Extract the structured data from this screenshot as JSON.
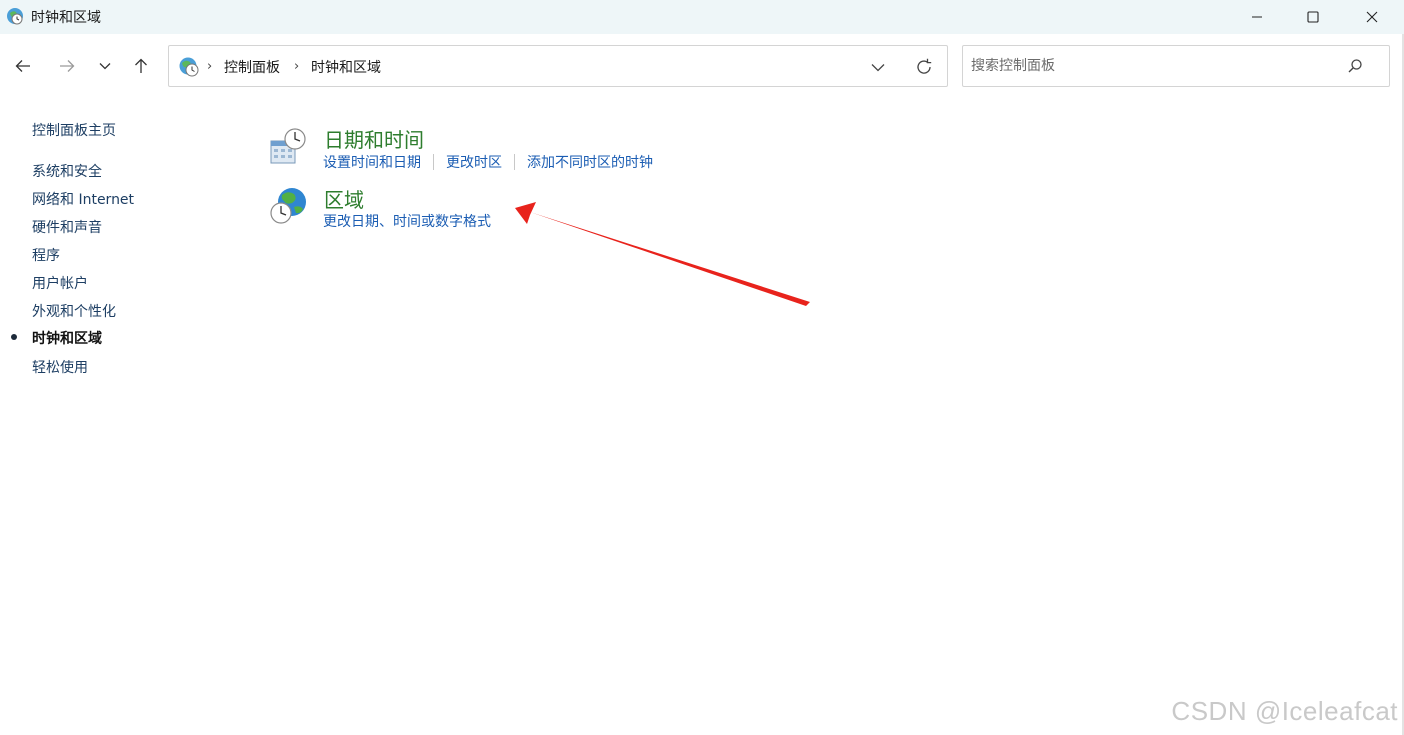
{
  "window": {
    "title": "时钟和区域"
  },
  "address_bar": {
    "crumbs": [
      "控制面板",
      "时钟和区域"
    ]
  },
  "search": {
    "placeholder": "搜索控制面板"
  },
  "sidebar": {
    "home": "控制面板主页",
    "items": [
      {
        "label": "系统和安全",
        "current": false
      },
      {
        "label": "网络和 Internet",
        "current": false
      },
      {
        "label": "硬件和声音",
        "current": false
      },
      {
        "label": "程序",
        "current": false
      },
      {
        "label": "用户帐户",
        "current": false
      },
      {
        "label": "外观和个性化",
        "current": false
      },
      {
        "label": "时钟和区域",
        "current": true
      },
      {
        "label": "轻松使用",
        "current": false
      }
    ]
  },
  "categories": [
    {
      "title": "日期和时间",
      "icon": "date-time-icon",
      "links": [
        "设置时间和日期",
        "更改时区",
        "添加不同时区的时钟"
      ]
    },
    {
      "title": "区域",
      "icon": "region-globe-icon",
      "links": [
        "更改日期、时间或数字格式"
      ]
    }
  ],
  "annotation": {
    "arrow_color": "#e8231c"
  },
  "watermark": "CSDN @Iceleafcat",
  "colors": {
    "link": "#1b5db3",
    "category_title": "#2e7d2e",
    "titlebar_bg": "#eef6f8"
  }
}
